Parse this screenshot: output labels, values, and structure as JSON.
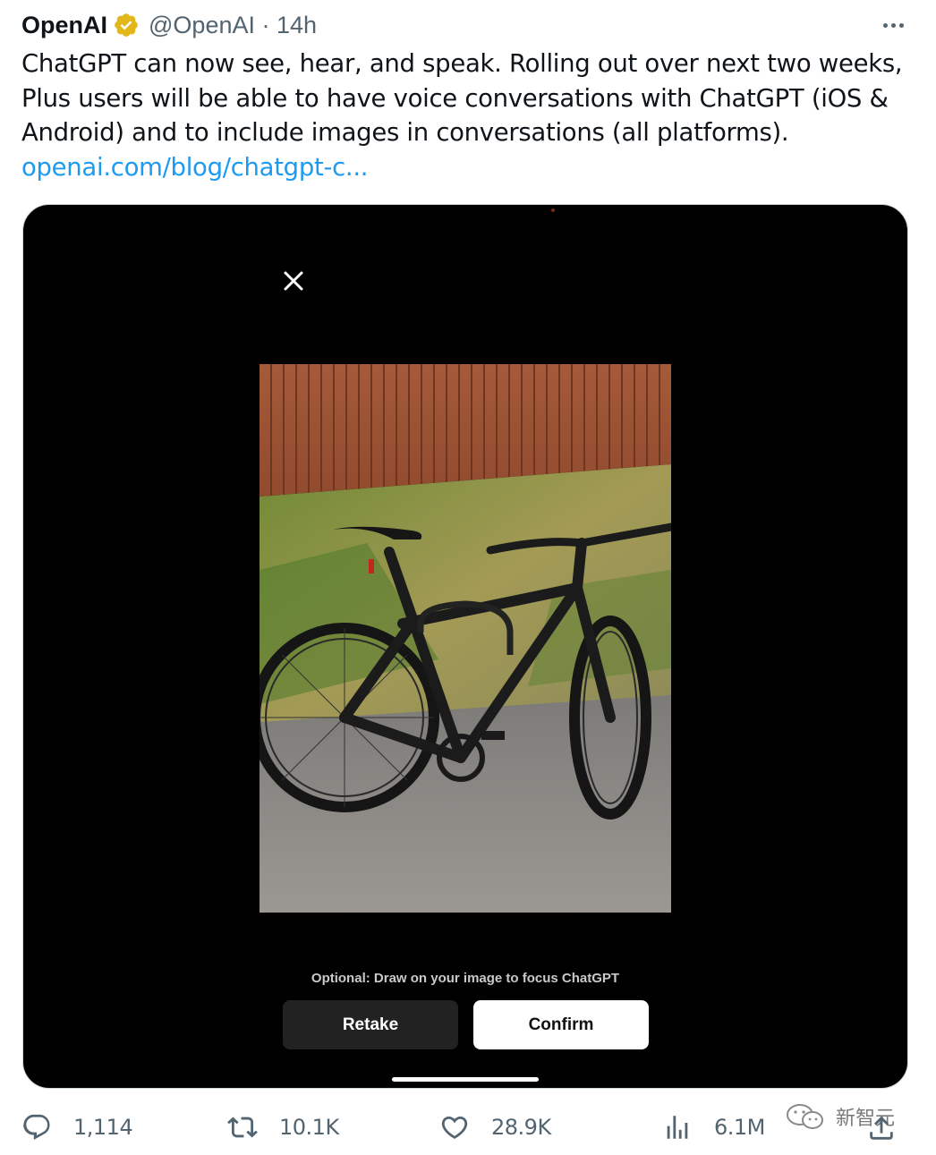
{
  "tweet": {
    "author_name": "OpenAI",
    "handle": "@OpenAI",
    "separator": "·",
    "time": "14h",
    "text_lines": [
      "ChatGPT can now see, hear, and speak. Rolling out over next two weeks,",
      "Plus users will be able to have voice conversations with ChatGPT (iOS &",
      "Android) and to include images in conversations (all platforms)."
    ],
    "link_text": "openai.com/blog/chatgpt-c...",
    "verified_color": "#e2b719",
    "link_color": "#1d9bf0"
  },
  "media": {
    "hint_text": "Optional: Draw on your image to focus ChatGPT",
    "retake_label": "Retake",
    "confirm_label": "Confirm",
    "close_icon": "close-icon"
  },
  "actions": {
    "replies": "1,114",
    "retweets": "10.1K",
    "likes": "28.9K",
    "views": "6.1M"
  },
  "watermark": {
    "text": "新智元"
  }
}
